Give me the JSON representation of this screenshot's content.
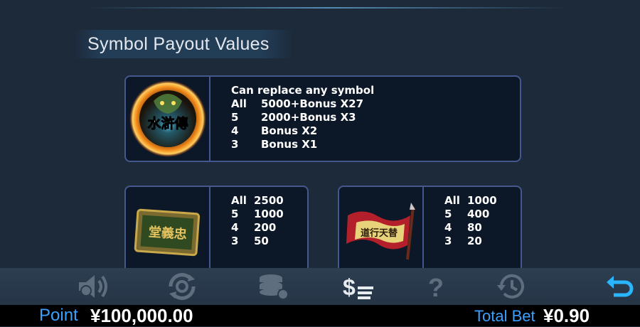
{
  "title": "Symbol Payout Values",
  "wild": {
    "image_text": "水滸傳",
    "description": "Can replace any symbol",
    "rows": [
      {
        "count": "All",
        "pay": "5000+Bonus X27"
      },
      {
        "count": "5",
        "pay": "2000+Bonus X3"
      },
      {
        "count": "4",
        "pay": "Bonus X2"
      },
      {
        "count": "3",
        "pay": "Bonus X1"
      }
    ]
  },
  "plaque": {
    "image_text": "堂義忠",
    "rows": [
      {
        "count": "All",
        "pay": "2500"
      },
      {
        "count": "5",
        "pay": "1000"
      },
      {
        "count": "4",
        "pay": "200"
      },
      {
        "count": "3",
        "pay": "50"
      }
    ]
  },
  "flag": {
    "image_text": "道行天替",
    "rows": [
      {
        "count": "All",
        "pay": "1000"
      },
      {
        "count": "5",
        "pay": "400"
      },
      {
        "count": "4",
        "pay": "80"
      },
      {
        "count": "3",
        "pay": "20"
      }
    ]
  },
  "toolbar": {
    "icons": [
      "sound-icon",
      "autoplay-icon",
      "bet-chips-icon",
      "paytable-icon",
      "help-icon",
      "history-icon",
      "back-icon"
    ]
  },
  "status": {
    "point_label": "Point",
    "point_value": "¥100,000.00",
    "bet_label": "Total Bet",
    "bet_value": "¥0.90"
  },
  "colors": {
    "background": "#1c2a3a",
    "card_border": "#45588e",
    "accent_blue": "#3aa0ff",
    "back_icon": "#29b6ff",
    "toolbar_icon_dim": "#5f6e7e"
  }
}
